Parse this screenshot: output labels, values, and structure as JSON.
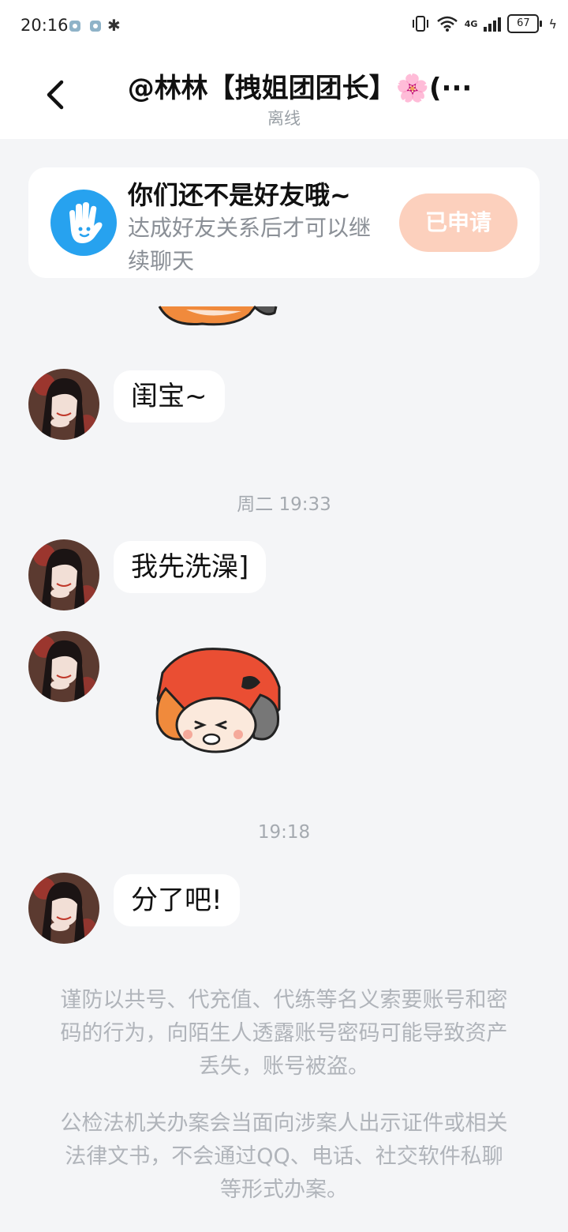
{
  "status_bar": {
    "time": "20:16",
    "network": "4G",
    "battery": "67"
  },
  "header": {
    "title": "@林林【拽姐团团长】🌸(···",
    "subtitle": "离线"
  },
  "friend_card": {
    "title": "你们还不是好友哦~",
    "description": "达成好友关系后才可以继续聊天",
    "button_label": "已申请",
    "button_color": "#fcd0bd"
  },
  "messages": [
    {
      "type": "text",
      "text": "闺宝~"
    },
    {
      "type": "timestamp",
      "text": "周二 19:33"
    },
    {
      "type": "text",
      "text": "我先洗澡]"
    },
    {
      "type": "sticker",
      "icon": "cartoon-girl-sticker"
    },
    {
      "type": "timestamp",
      "text": "19:18"
    },
    {
      "type": "text",
      "text": "分了吧!"
    }
  ],
  "notices": [
    "谨防以共号、代充值、代练等名义索要账号和密码的行为，向陌生人透露账号密码可能导致资产丢失，账号被盗。",
    "公检法机关办案会当面向涉案人出示证件或相关法律文书，不会通过QQ、电话、社交软件私聊等形式办案。"
  ],
  "colors": {
    "accent_blue": "#27a2ef",
    "background": "#f4f5f7",
    "notice_text": "#b0b4ba"
  }
}
